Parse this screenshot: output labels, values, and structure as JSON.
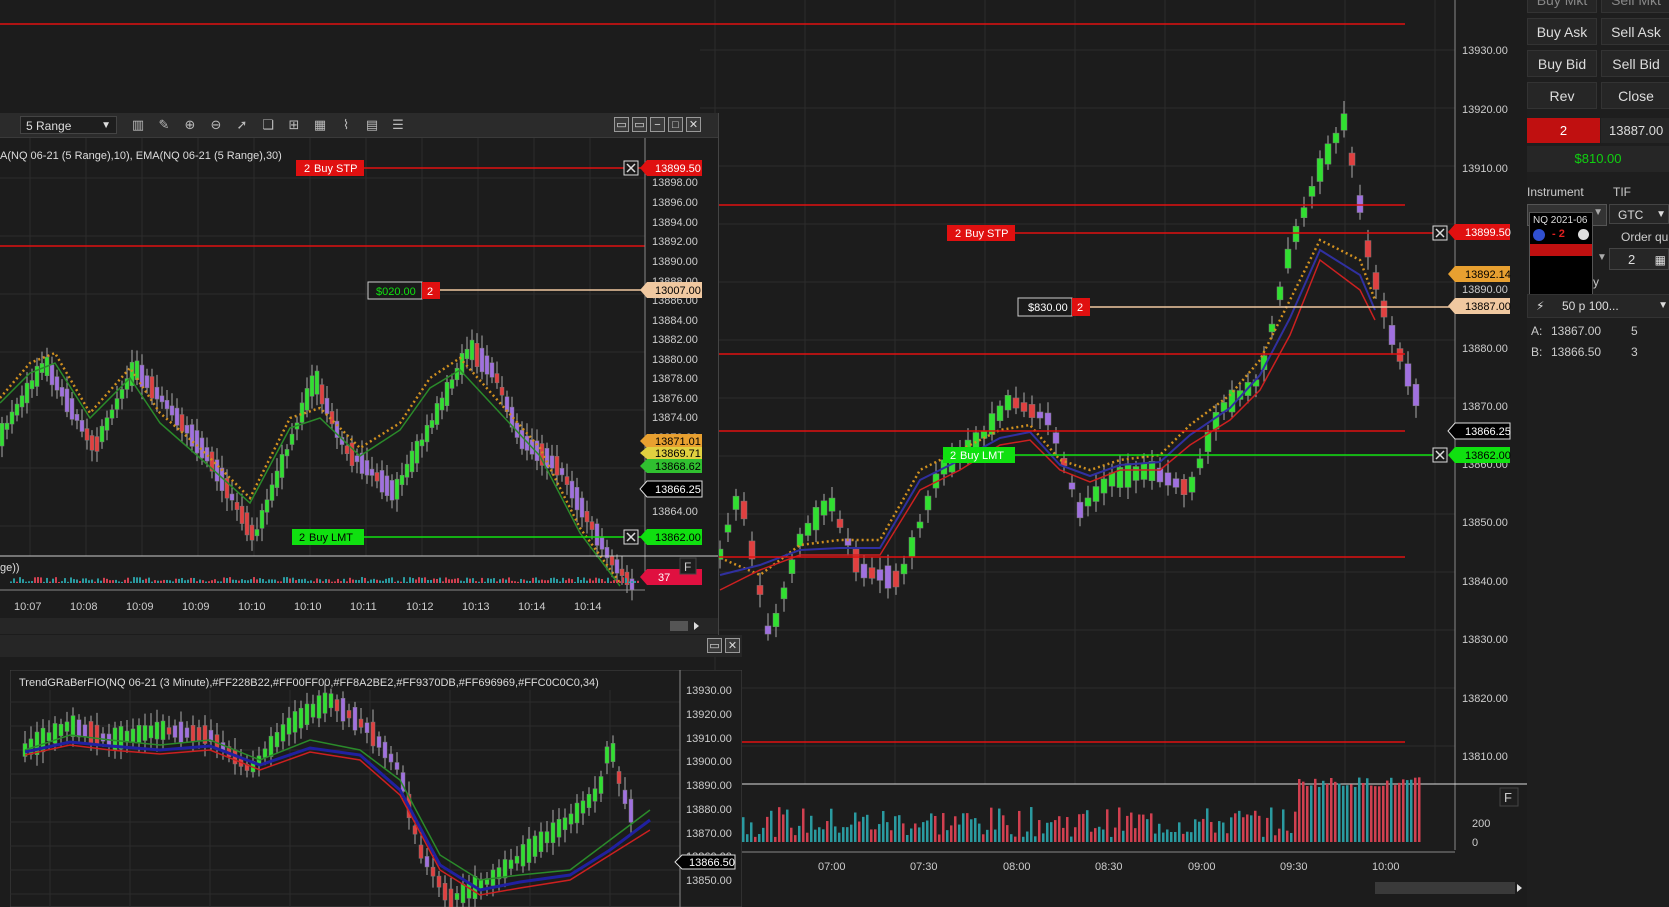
{
  "left_top_chart": {
    "range_select": "5 Range",
    "indicator_label": "A(NQ 06-21 (5 Range),10), EMA(NQ 06-21 (5 Range),30)",
    "price_ticks": [
      "13899.50",
      "13898.00",
      "13896.00",
      "13894.00",
      "13892.00",
      "13890.00",
      "13888.00",
      "13886.00",
      "13884.00",
      "13882.00",
      "13880.00",
      "13878.00",
      "13876.00",
      "13874.00",
      "13872.00",
      "13864.00"
    ],
    "tags": {
      "stop": "13899.50",
      "pos": "13007.00",
      "gold": "13871.01",
      "yellow": "13869.71",
      "green_avg": "13868.62",
      "last": "13866.25",
      "limit": "13862.00",
      "vol": "37"
    },
    "orders": {
      "stop_qty": "2",
      "stop_label": "Buy STP",
      "limit_qty": "2",
      "limit_label": "Buy LMT",
      "pnl": "$020.00",
      "pnl_qty": "2"
    },
    "volume_label": "ge))",
    "f_button": "F",
    "time_ticks": [
      "10:07",
      "10:08",
      "10:09",
      "10:09",
      "10:10",
      "10:10",
      "10:11",
      "10:12",
      "10:13",
      "10:14",
      "10:14"
    ]
  },
  "left_bottom_chart": {
    "indicator_label": "TrendGRaBerFIO(NQ 06-21 (3 Minute),#FF228B22,#FF00FF00,#FF8A2BE2,#FF9370DB,#FF696969,#FFC0C0C0,34)",
    "price_ticks": [
      "13930.00",
      "13920.00",
      "13910.00",
      "13900.00",
      "13890.00",
      "13880.00",
      "13870.00",
      "13860.00",
      "13850.00"
    ],
    "last_tag": "13866.50"
  },
  "main_chart": {
    "price_ticks": [
      "13930.00",
      "13920.00",
      "13910.00",
      "13890.00",
      "13880.00",
      "13870.00",
      "13860.00",
      "13850.00",
      "13840.00",
      "13830.00",
      "13820.00",
      "13810.00"
    ],
    "tags": {
      "stop": "13899.50",
      "gold": "13892.14",
      "pos": "13887.00",
      "last": "13866.25",
      "limit": "13862.00"
    },
    "orders": {
      "stop_qty": "2",
      "stop_label": "Buy STP",
      "limit_qty": "2",
      "limit_label": "Buy LMT",
      "pnl": "$830.00",
      "pnl_qty": "2"
    },
    "volume_ticks": [
      "200",
      "0"
    ],
    "f_button": "F",
    "time_ticks": [
      "30",
      "07:00",
      "07:30",
      "08:00",
      "08:30",
      "09:00",
      "09:30",
      "10:00"
    ]
  },
  "order_panel": {
    "buttons": {
      "buy_ask": "Buy Ask",
      "sell_ask": "Sell Ask",
      "buy_bid": "Buy Bid",
      "sell_bid": "Sell Bid",
      "rev": "Rev",
      "close": "Close",
      "top_left": "Buy Mkt",
      "top_right": "Sell Mkt"
    },
    "position_qty": "2",
    "position_price": "13887.00",
    "pnl": "$810.00",
    "instrument_label": "Instrument",
    "tif_label": "TIF",
    "tif_value": "GTC",
    "instrument_value": "NQ 2021-06",
    "order_qty_label": "Order qu",
    "popup_qty": "- 2",
    "qty_value": "2",
    "y_label": "y",
    "atm": "50 p 100...",
    "ask_label": "A:",
    "ask_price": "13867.00",
    "ask_size": "5",
    "bid_label": "B:",
    "bid_price": "13866.50",
    "bid_size": "3"
  }
}
